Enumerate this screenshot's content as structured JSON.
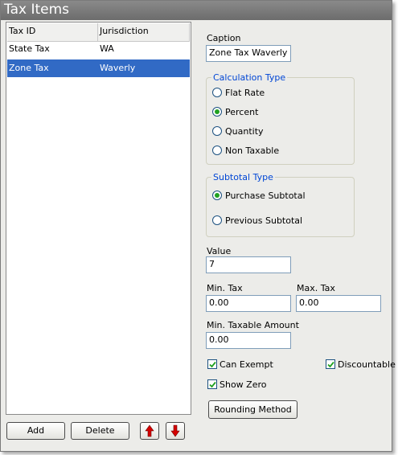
{
  "window": {
    "title": "Tax Items"
  },
  "table": {
    "columns": [
      "Tax ID",
      "Jurisdiction"
    ],
    "rows": [
      {
        "tax_id": "State Tax",
        "jurisdiction": "WA",
        "selected": false
      },
      {
        "tax_id": "Zone Tax",
        "jurisdiction": "Waverly",
        "selected": true
      }
    ]
  },
  "buttons": {
    "add": "Add",
    "delete": "Delete",
    "move_up": "up-arrow-icon",
    "move_down": "down-arrow-icon",
    "rounding": "Rounding Method"
  },
  "caption": {
    "label": "Caption",
    "value": "Zone Tax Waverly"
  },
  "calculation_type": {
    "label": "Calculation Type",
    "options": [
      "Flat Rate",
      "Percent",
      "Quantity",
      "Non Taxable"
    ],
    "selected": "Percent"
  },
  "subtotal_type": {
    "label": "Subtotal Type",
    "options": [
      "Purchase Subtotal",
      "Previous Subtotal"
    ],
    "selected": "Purchase Subtotal"
  },
  "value": {
    "label": "Value",
    "value": "7"
  },
  "min_tax": {
    "label": "Min. Tax",
    "value": "0.00"
  },
  "max_tax": {
    "label": "Max. Tax",
    "value": "0.00"
  },
  "min_taxable": {
    "label": "Min. Taxable Amount",
    "value": "0.00"
  },
  "checkboxes": {
    "can_exempt": {
      "label": "Can Exempt",
      "checked": true
    },
    "discountable": {
      "label": "Discountable",
      "checked": true
    },
    "show_zero": {
      "label": "Show Zero",
      "checked": true
    }
  },
  "colors": {
    "selection": "#316ac5",
    "group_label": "#0046d5",
    "arrow": "#d40000",
    "radio_dot": "#21a121"
  }
}
